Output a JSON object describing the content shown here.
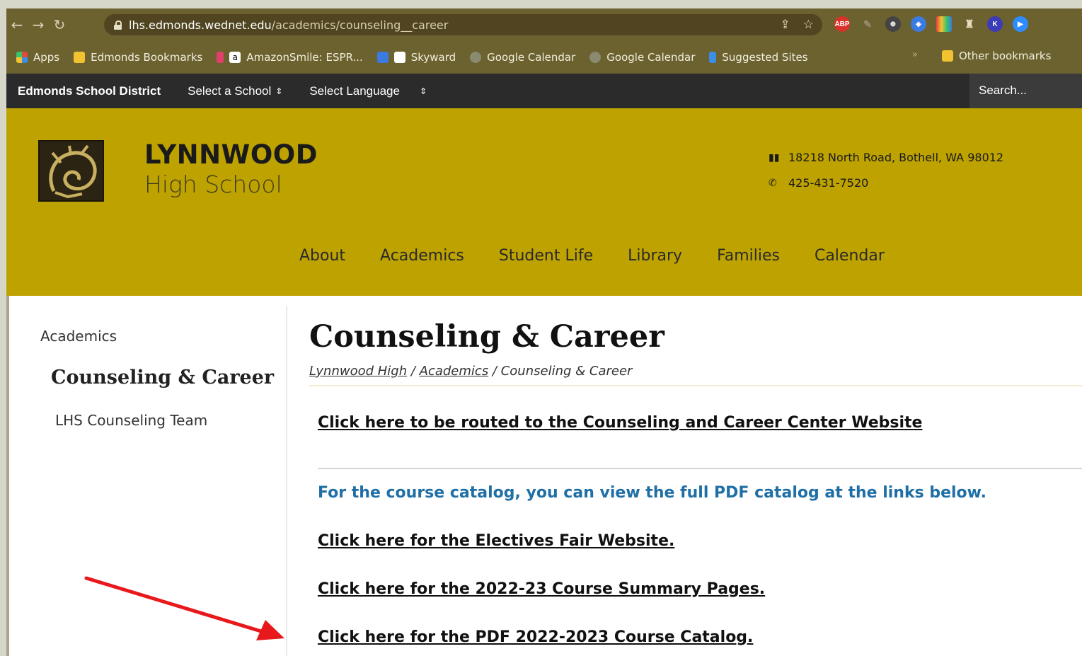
{
  "browser": {
    "url_host": "lhs.edmonds.wednet.edu",
    "url_path": "/academics/counseling__career",
    "extensions": [
      "ABP",
      "K"
    ],
    "bookmarks": [
      {
        "label": "Apps",
        "color": "#e04b3a"
      },
      {
        "label": "Edmonds Bookmarks",
        "color": "#f2c230"
      },
      {
        "label": "AmazonSmile: ESPR...",
        "color": "#222222"
      },
      {
        "label": "Skyward",
        "color": "#ffffff"
      },
      {
        "label": "Google Calendar",
        "color": "#8a8a70"
      },
      {
        "label": "Google Calendar",
        "color": "#8a8a70"
      },
      {
        "label": "Suggested Sites",
        "color": "#3a8ee6"
      }
    ],
    "bookmarks_more": "»",
    "other_bookmarks": "Other bookmarks"
  },
  "district": {
    "title": "Edmonds School District",
    "select_school": "Select a School",
    "select_language": "Select Language",
    "search_placeholder": "Search..."
  },
  "header": {
    "school_name": "LYNNWOOD",
    "school_sub": "High School",
    "address": "18218 North Road, Bothell, WA 98012",
    "phone": "425-431-7520",
    "nav": [
      "About",
      "Academics",
      "Student Life",
      "Library",
      "Families",
      "Calendar"
    ]
  },
  "sidebar": {
    "crumb": "Academics",
    "title": "Counseling & Career",
    "items": [
      "LHS Counseling Team"
    ]
  },
  "main": {
    "title": "Counseling & Career",
    "breadcrumb": [
      "Lynnwood High",
      "Academics",
      "Counseling & Career"
    ],
    "breadcrumb_sep": " / ",
    "link_center": "Click here to be routed to the Counseling and Career Center Website",
    "catalog_note": "For the course catalog, you can view the full PDF catalog at the links below.",
    "link_electives": "Click here for the Electives Fair Website.",
    "link_summary": "Click here for the 2022-23 Course Summary Pages.",
    "link_pdf": "Click here for the PDF 2022-2023 Course Catalog."
  },
  "colors": {
    "header_gold": "#bda200",
    "district_bar": "#2b2b2b",
    "note_blue": "#1f6fa6",
    "arrow_red": "#e8191c"
  }
}
